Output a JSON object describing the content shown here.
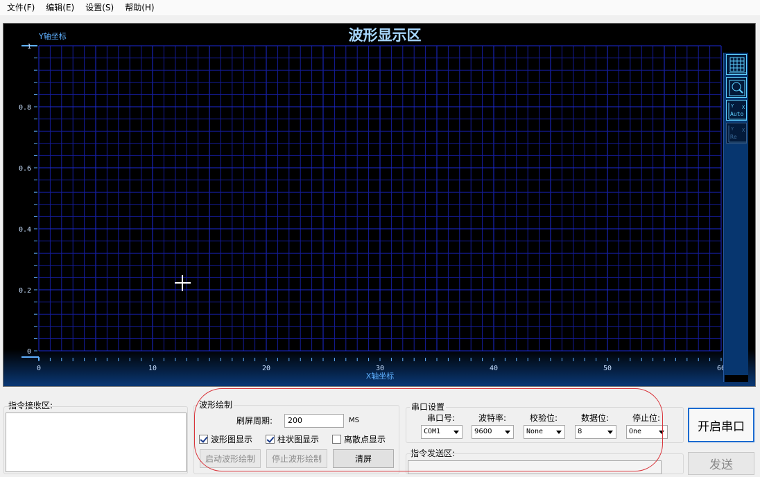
{
  "menu": [
    "文件(F)",
    "编辑(E)",
    "设置(S)",
    "帮助(H)"
  ],
  "chart": {
    "title": "波形显示区",
    "ylabel": "Y轴坐标",
    "xlabel": "X轴坐标"
  },
  "chart_data": {
    "type": "line",
    "title": "波形显示区",
    "xlabel": "X轴坐标",
    "ylabel": "Y轴坐标",
    "xlim": [
      0,
      60
    ],
    "ylim": [
      0,
      1
    ],
    "x_ticks": [
      "0",
      "10",
      "20",
      "30",
      "40",
      "50",
      "60"
    ],
    "y_ticks": [
      "0",
      "0.2",
      "0.4",
      "0.6",
      "0.8",
      "1"
    ],
    "grid": true,
    "series": []
  },
  "toolbar": {
    "auto_label": "Auto",
    "reset_label": "Re"
  },
  "recv": {
    "label": "指令接收区:",
    "value": ""
  },
  "wave": {
    "group_label": "波形绘制",
    "period_label": "刷屏周期:",
    "period_value": "200",
    "period_unit": "MS",
    "chk_wave": "波形图显示",
    "chk_bar": "柱状图显示",
    "chk_scatter": "离散点显示",
    "start_btn": "启动波形绘制",
    "stop_btn": "停止波形绘制",
    "clear_btn": "清屏"
  },
  "serial": {
    "group_label": "串口设置",
    "port_label": "串口号:",
    "port_value": "COM1",
    "baud_label": "波特率:",
    "baud_value": "9600",
    "parity_label": "校验位:",
    "parity_value": "None",
    "databits_label": "数据位:",
    "databits_value": "8",
    "stopbits_label": "停止位:",
    "stopbits_value": "One",
    "send_area_label": "指令发送区:",
    "send_value": ""
  },
  "actions": {
    "open_port": "开启串口",
    "send": "发送"
  }
}
